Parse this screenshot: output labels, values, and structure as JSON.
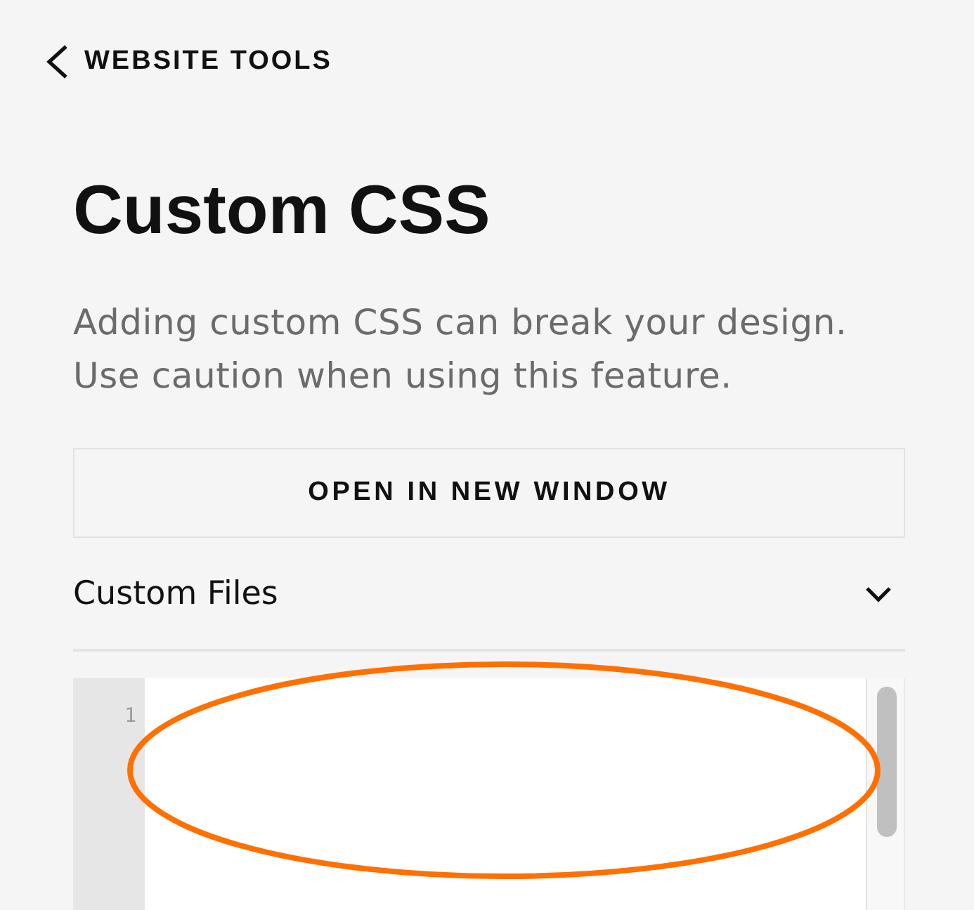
{
  "back_link": {
    "label": "WEBSITE TOOLS"
  },
  "title": "Custom CSS",
  "description": "Adding custom CSS can break your design. Use caution when using this feature.",
  "open_button": {
    "label": "OPEN IN NEW WINDOW"
  },
  "section": {
    "label": "Custom Files"
  },
  "editor": {
    "line_numbers": [
      "1"
    ]
  },
  "annotations": [
    {
      "kind": "ellipse"
    }
  ]
}
